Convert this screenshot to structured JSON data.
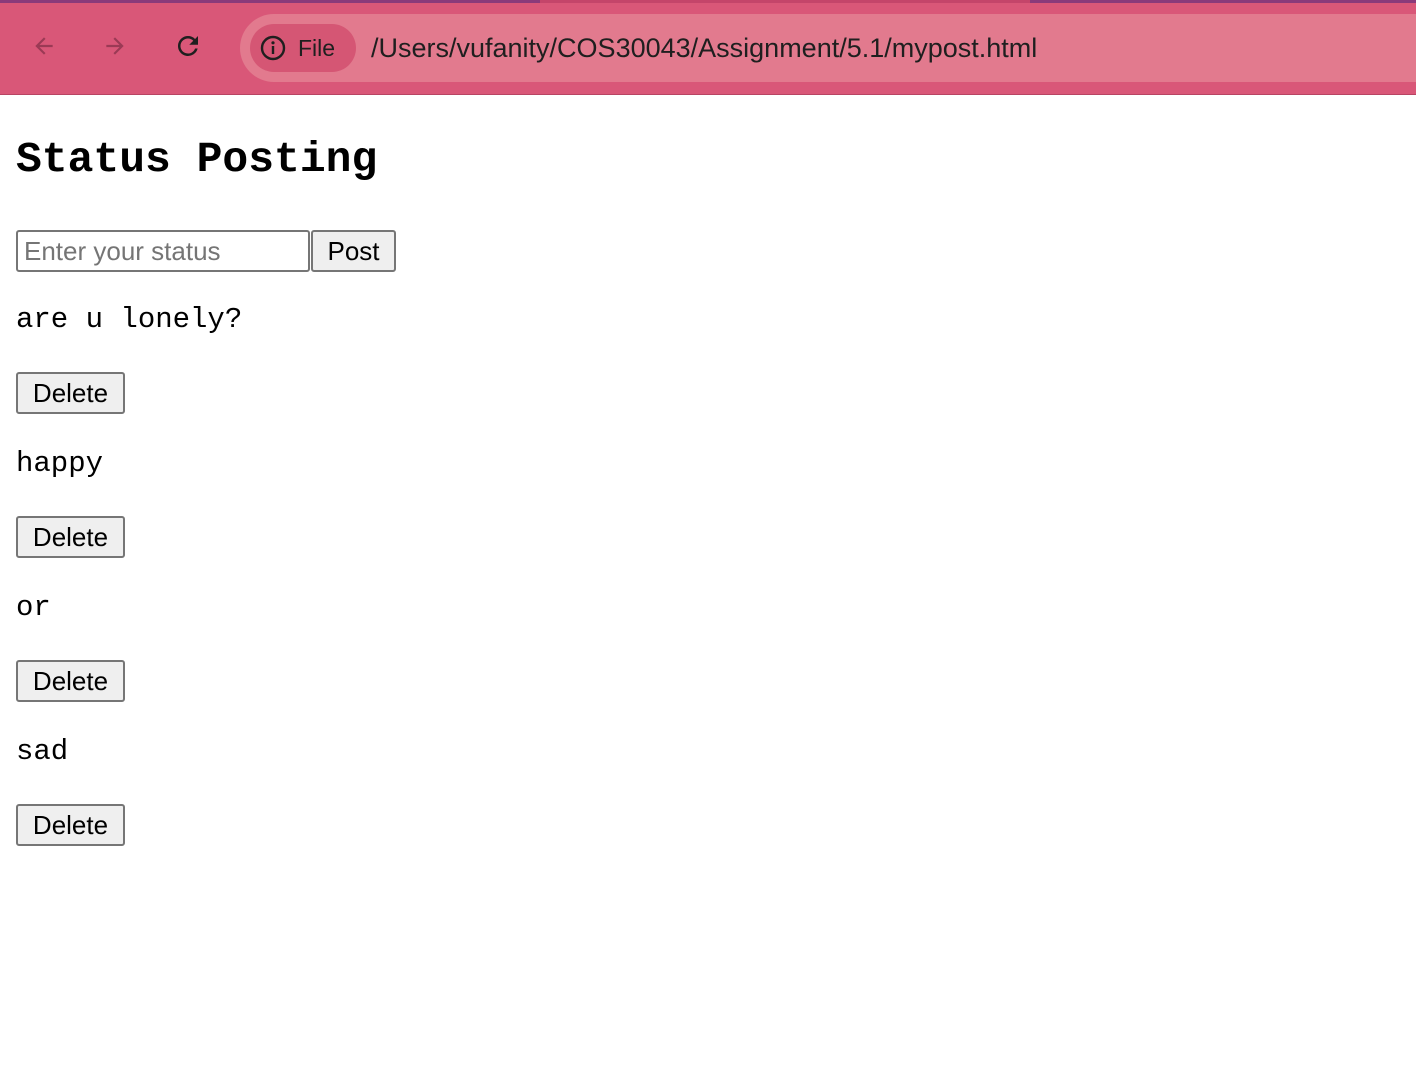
{
  "browser": {
    "chip_label": "File",
    "url": "/Users/vufanity/COS30043/Assignment/5.1/mypost.html",
    "colors": {
      "toolbar": "#d95778",
      "omnibox": "#e27a8e",
      "chip": "#d55674"
    }
  },
  "page": {
    "title": "Status Posting",
    "input_placeholder": "Enter your status",
    "input_value": "",
    "post_label": "Post",
    "statuses": [
      {
        "text": "are u lonely?",
        "delete_label": "Delete"
      },
      {
        "text": "happy",
        "delete_label": "Delete"
      },
      {
        "text": "or",
        "delete_label": "Delete"
      },
      {
        "text": "sad",
        "delete_label": "Delete"
      }
    ]
  }
}
